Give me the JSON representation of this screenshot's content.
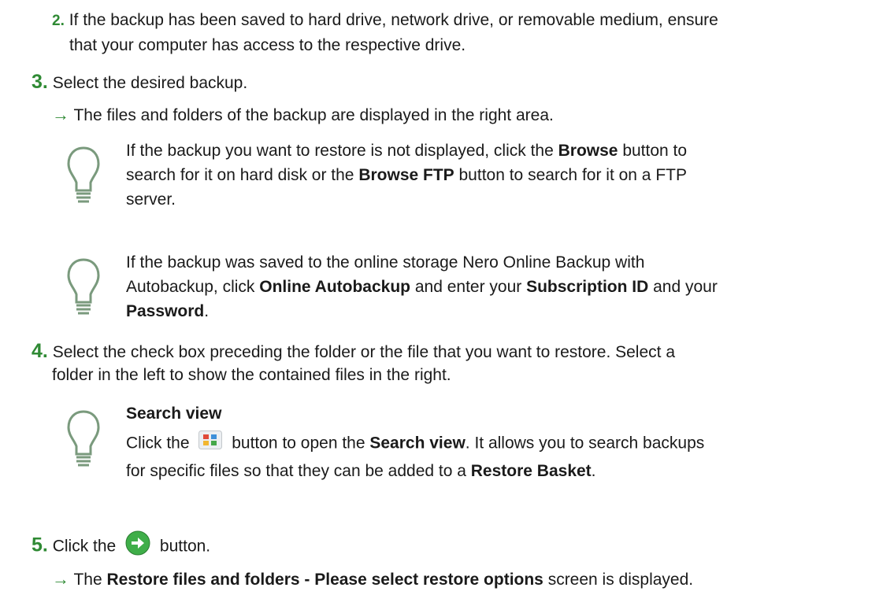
{
  "step2": {
    "number": "2.",
    "line1": "If the backup has been saved to hard drive, network drive, or removable medium, ensure",
    "line2": "that your computer has access to the respective drive."
  },
  "step3": {
    "number": "3.",
    "text": "Select the desired backup.",
    "result_arrow": "→",
    "result": "The files and folders of the backup are displayed in the right area."
  },
  "tip1": {
    "l1_a": "If the backup you want to restore is not displayed, click the ",
    "l1_b": "Browse",
    "l1_c": " button to",
    "l2_a": "search for it on hard disk or the ",
    "l2_b": "Browse FTP",
    "l2_c": " button to search for it on a FTP",
    "l3": "server."
  },
  "tip2": {
    "l1": "If the backup was saved to the online storage Nero Online Backup with",
    "l2_a": "Autobackup, click ",
    "l2_b": "Online Autobackup",
    "l2_c": " and enter your ",
    "l2_d": "Subscription ID",
    "l2_e": " and your",
    "l3_a": "Password",
    "l3_b": "."
  },
  "step4": {
    "number": "4.",
    "line1": "Select the check box preceding the folder or the file that you want to restore. Select a",
    "line2": "folder in the left to show the contained files in the right."
  },
  "tip3": {
    "title": "Search view",
    "l1_a": "Click the",
    "l1_b": "button to open the ",
    "l1_c": "Search view",
    "l1_d": ". It allows you to search backups",
    "l2_a": "for specific files so that they can be added to a ",
    "l2_b": "Restore Basket",
    "l2_c": "."
  },
  "step5": {
    "number": "5.",
    "text_a": "Click the",
    "text_b": "button.",
    "result_arrow": "→",
    "result_a": "The ",
    "result_b": "Restore files and folders - Please select restore options",
    "result_c": " screen is displayed."
  },
  "colors": {
    "accent_green": "#2f8a34",
    "bulb_outline": "#7a9a7d",
    "text": "#1a1a1a"
  }
}
